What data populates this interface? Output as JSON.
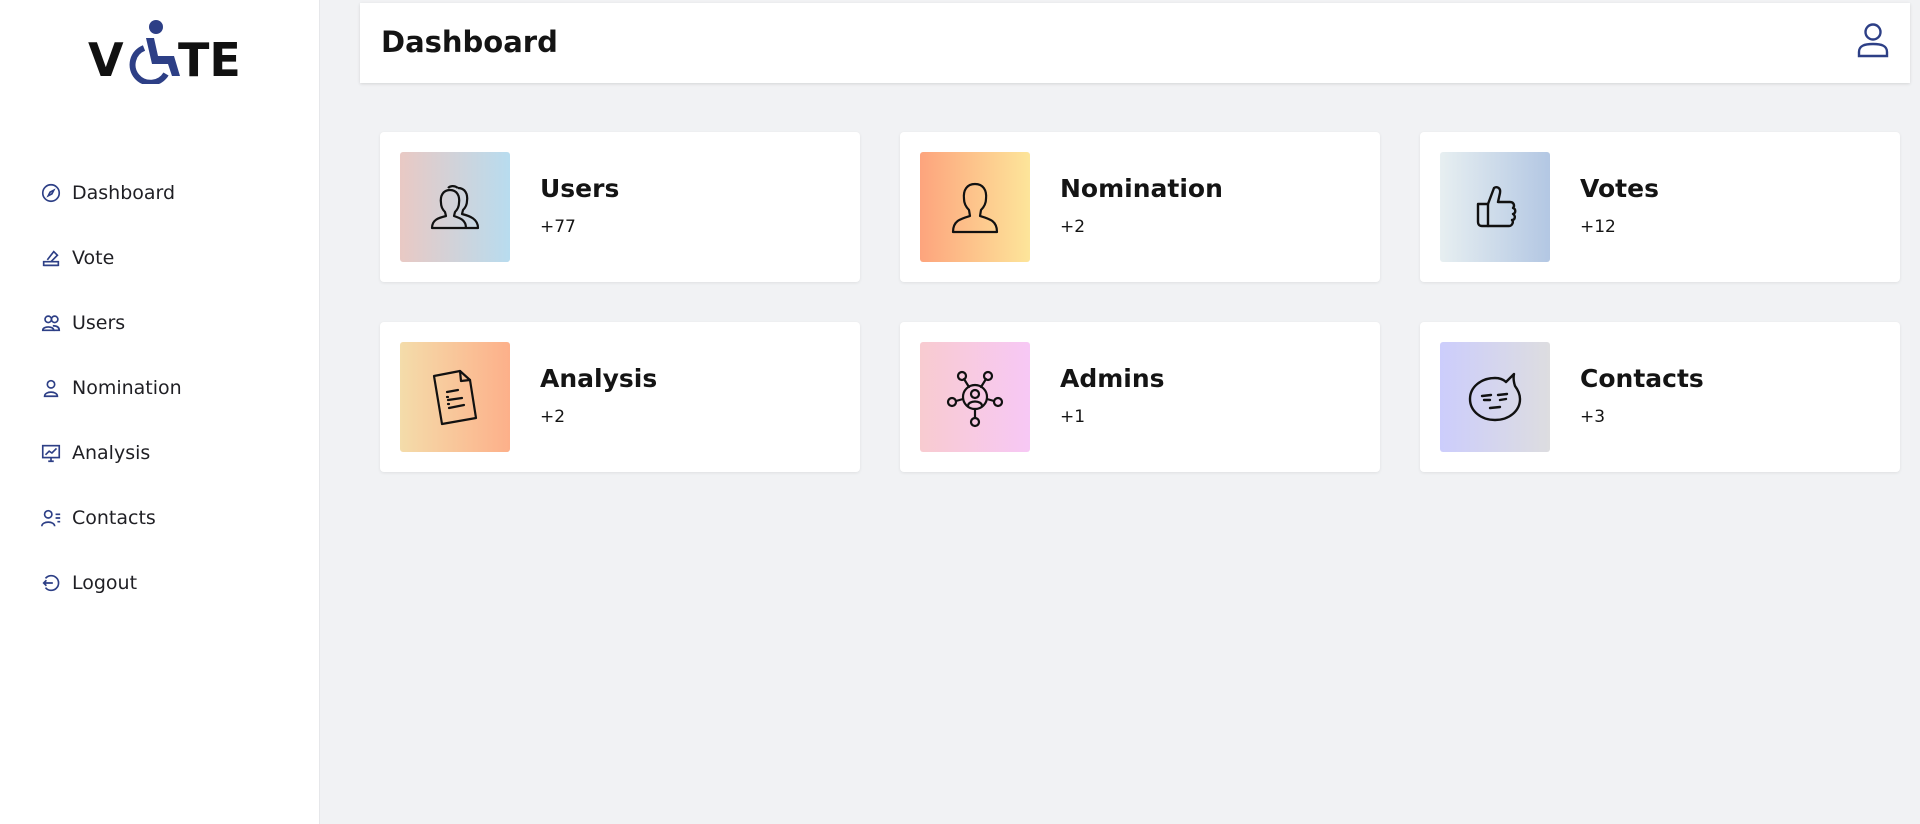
{
  "brand": {
    "logo_text": "VOTE",
    "accent": "#2d3f86"
  },
  "sidebar": {
    "items": [
      {
        "label": "Dashboard",
        "icon": "compass-icon"
      },
      {
        "label": "Vote",
        "icon": "ballot-icon"
      },
      {
        "label": "Users",
        "icon": "users-icon"
      },
      {
        "label": "Nomination",
        "icon": "user-icon"
      },
      {
        "label": "Analysis",
        "icon": "chart-icon"
      },
      {
        "label": "Contacts",
        "icon": "contacts-icon"
      },
      {
        "label": "Logout",
        "icon": "logout-icon"
      }
    ]
  },
  "header": {
    "title": "Dashboard",
    "profile_icon": "profile-icon"
  },
  "cards": [
    {
      "title": "Users",
      "count": "+77",
      "icon": "users-outline-icon",
      "gradient": [
        "#e9c9c4",
        "#b8dcef"
      ]
    },
    {
      "title": "Nomination",
      "count": "+2",
      "icon": "person-outline-icon",
      "gradient": [
        "#fda47d",
        "#fde59a"
      ]
    },
    {
      "title": "Votes",
      "count": "+12",
      "icon": "thumbs-up-icon",
      "gradient": [
        "#e7eff1",
        "#b3c7e3"
      ]
    },
    {
      "title": "Analysis",
      "count": "+2",
      "icon": "document-icon",
      "gradient": [
        "#f4dcaa",
        "#fdb08a"
      ]
    },
    {
      "title": "Admins",
      "count": "+1",
      "icon": "network-icon",
      "gradient": [
        "#f8cbd0",
        "#f7c8f5"
      ]
    },
    {
      "title": "Contacts",
      "count": "+3",
      "icon": "chat-face-icon",
      "gradient": [
        "#cccdfc",
        "#dddde0"
      ]
    }
  ]
}
